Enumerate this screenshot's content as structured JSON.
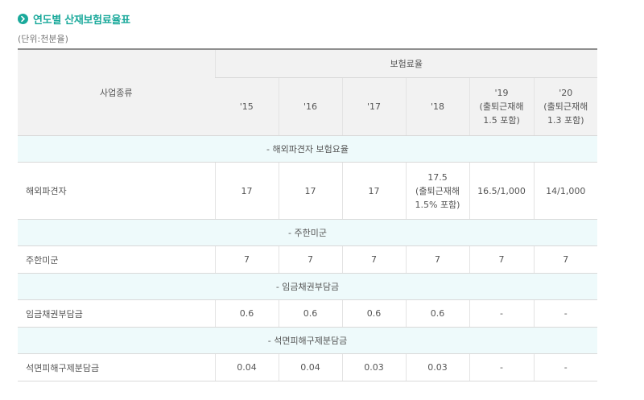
{
  "page": {
    "title": "연도별 산재보험료율표",
    "unit": "(단위:천분율)"
  },
  "table": {
    "header_left": "사업종류",
    "header_group": "보험료율",
    "years": [
      {
        "lines": [
          "'15"
        ]
      },
      {
        "lines": [
          "'16"
        ]
      },
      {
        "lines": [
          "'17"
        ]
      },
      {
        "lines": [
          "'18"
        ]
      },
      {
        "lines": [
          "'19",
          "(출퇴근재해",
          "1.5 포함)"
        ]
      },
      {
        "lines": [
          "'20",
          "(출퇴근재해",
          "1.3 포함)"
        ]
      }
    ],
    "sections": [
      {
        "title": "- 해외파견자 보험요율",
        "row_name": "해외파견자",
        "tall": true,
        "values": [
          {
            "lines": [
              "17"
            ]
          },
          {
            "lines": [
              "17"
            ]
          },
          {
            "lines": [
              "17"
            ]
          },
          {
            "lines": [
              "17.5",
              "(출퇴근재해",
              "1.5% 포함)"
            ]
          },
          {
            "lines": [
              "16.5/1,000"
            ]
          },
          {
            "lines": [
              "14/1,000"
            ]
          }
        ]
      },
      {
        "title": "- 주한미군",
        "row_name": "주한미군",
        "tall": false,
        "values": [
          {
            "lines": [
              "7"
            ]
          },
          {
            "lines": [
              "7"
            ]
          },
          {
            "lines": [
              "7"
            ]
          },
          {
            "lines": [
              "7"
            ]
          },
          {
            "lines": [
              "7"
            ]
          },
          {
            "lines": [
              "7"
            ]
          }
        ]
      },
      {
        "title": "- 임금채권부담금",
        "row_name": "임금채권부담금",
        "tall": false,
        "values": [
          {
            "lines": [
              "0.6"
            ]
          },
          {
            "lines": [
              "0.6"
            ]
          },
          {
            "lines": [
              "0.6"
            ]
          },
          {
            "lines": [
              "0.6"
            ]
          },
          {
            "lines": [
              "-"
            ]
          },
          {
            "lines": [
              "-"
            ]
          }
        ]
      },
      {
        "title": "- 석면피해구제분담금",
        "row_name": "석면피해구제분담금",
        "tall": false,
        "values": [
          {
            "lines": [
              "0.04"
            ]
          },
          {
            "lines": [
              "0.04"
            ]
          },
          {
            "lines": [
              "0.03"
            ]
          },
          {
            "lines": [
              "0.03"
            ]
          },
          {
            "lines": [
              "-"
            ]
          },
          {
            "lines": [
              "-"
            ]
          }
        ]
      }
    ]
  },
  "colors": {
    "accent": "#1aa99b",
    "header_bg": "#f2f2f2",
    "section_bg": "#eefafb"
  }
}
